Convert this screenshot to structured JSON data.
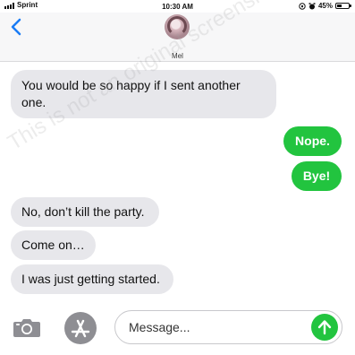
{
  "status_bar": {
    "carrier": "Sprint",
    "time": "10:30 AM",
    "battery_percent": "45%",
    "battery_level": 0.45
  },
  "header": {
    "back_icon": "chevron-left-icon",
    "contact_name": "Mel"
  },
  "messages": [
    {
      "direction": "received",
      "text": "You would be so happy if I sent another one."
    },
    {
      "direction": "sent",
      "text": "Nope."
    },
    {
      "direction": "sent",
      "text": "Bye!"
    },
    {
      "direction": "received",
      "text": "No, don’t kill the party."
    },
    {
      "direction": "received",
      "text": "Come on…"
    },
    {
      "direction": "received",
      "text": "I was just getting started."
    }
  ],
  "watermark": "This is not an original screenshot!!!",
  "input_bar": {
    "camera_icon": "camera-icon",
    "apps_icon": "app-store-icon",
    "placeholder": "Message...",
    "send_icon": "arrow-up-icon"
  },
  "colors": {
    "sent_bubble": "#22c43f",
    "received_bubble": "#e7e7eb",
    "accent_blue": "#1a7cf5"
  }
}
